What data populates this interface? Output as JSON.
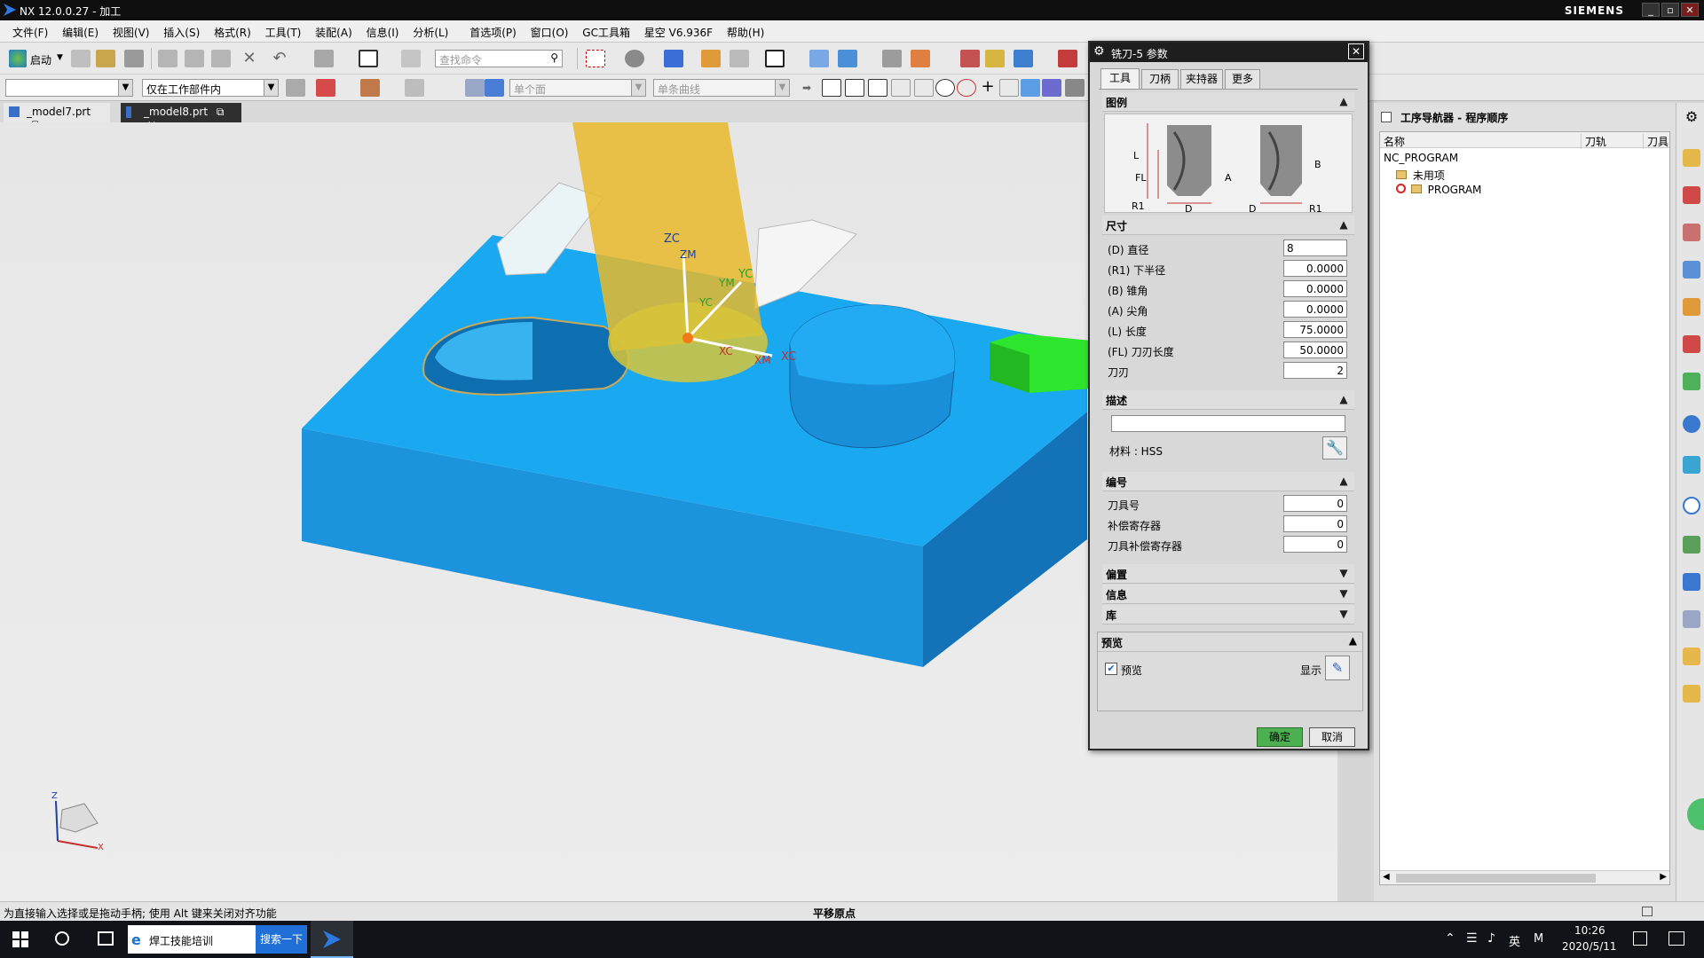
{
  "app": {
    "title": "NX 12.0.0.27 - 加工",
    "brand": "SIEMENS"
  },
  "menu": [
    "文件(F)",
    "编辑(E)",
    "视图(V)",
    "插入(S)",
    "格式(R)",
    "工具(T)",
    "装配(A)",
    "信息(I)",
    "分析(L)",
    "首选项(P)",
    "窗口(O)",
    "GC工具箱",
    "星空 V6.936F",
    "帮助(H)"
  ],
  "toolbar": {
    "start_label": "启动",
    "search_placeholder": "查找命令",
    "filter_value": "仅在工作部件内",
    "face_rule": "单个面",
    "curve_rule": "单条曲线"
  },
  "file_tabs": [
    "_model7.prt",
    "_model8.prt"
  ],
  "viewport": {
    "labels": {
      "zc": "ZC",
      "zm": "ZM",
      "ym": "YM",
      "yc": "YC",
      "xc1": "XC",
      "xm": "XM",
      "xc2": "XC",
      "yc2": "YC"
    },
    "triad": {
      "x": "X",
      "z": "Z"
    }
  },
  "dialog": {
    "title": "铣刀-5 参数",
    "tabs": [
      "工具",
      "刀柄",
      "夹持器",
      "更多"
    ],
    "sections": {
      "legend": "图例",
      "size": "尺寸",
      "desc": "描述",
      "number": "编号",
      "offset": "偏置",
      "info": "信息",
      "library": "库",
      "preview": "预览"
    },
    "legend_labels": {
      "L": "L",
      "FL": "FL",
      "R1a": "R1",
      "D1": "D",
      "A": "A",
      "B": "B",
      "D2": "D",
      "R1b": "R1"
    },
    "size_fields": [
      {
        "label": "(D) 直径",
        "value": "8"
      },
      {
        "label": "(R1) 下半径",
        "value": "0.0000"
      },
      {
        "label": "(B) 锥角",
        "value": "0.0000"
      },
      {
        "label": "(A) 尖角",
        "value": "0.0000"
      },
      {
        "label": "(L) 长度",
        "value": "75.0000"
      },
      {
        "label": "(FL) 刀刃长度",
        "value": "50.0000"
      },
      {
        "label": "刀刃",
        "value": "2"
      }
    ],
    "material_label": "材料 : HSS",
    "number_fields": [
      {
        "label": "刀具号",
        "value": "0"
      },
      {
        "label": "补偿寄存器",
        "value": "0"
      },
      {
        "label": "刀具补偿寄存器",
        "value": "0"
      }
    ],
    "preview_checkbox": "预览",
    "display_label": "显示",
    "ok": "确定",
    "cancel": "取消"
  },
  "navigator": {
    "title": "工序导航器 - 程序顺序",
    "columns": [
      "名称",
      "刀轨",
      "刀具"
    ],
    "rows": [
      "NC_PROGRAM",
      "未用项",
      "PROGRAM"
    ]
  },
  "status": {
    "message": "为直接输入选择或是拖动手柄; 使用 Alt 键来关闭对齐功能",
    "center": "平移原点"
  },
  "taskbar": {
    "search_text": "焊工技能培训",
    "search_button": "搜索一下",
    "lang": "英",
    "ime": "M",
    "time": "10:26",
    "date": "2020/5/11"
  },
  "colors": {
    "part_blue": "#1aa9f0",
    "tool_yellow": "#e9b82a",
    "fixture_green": "#2ee62e",
    "ok_green": "#3a9e3a"
  }
}
